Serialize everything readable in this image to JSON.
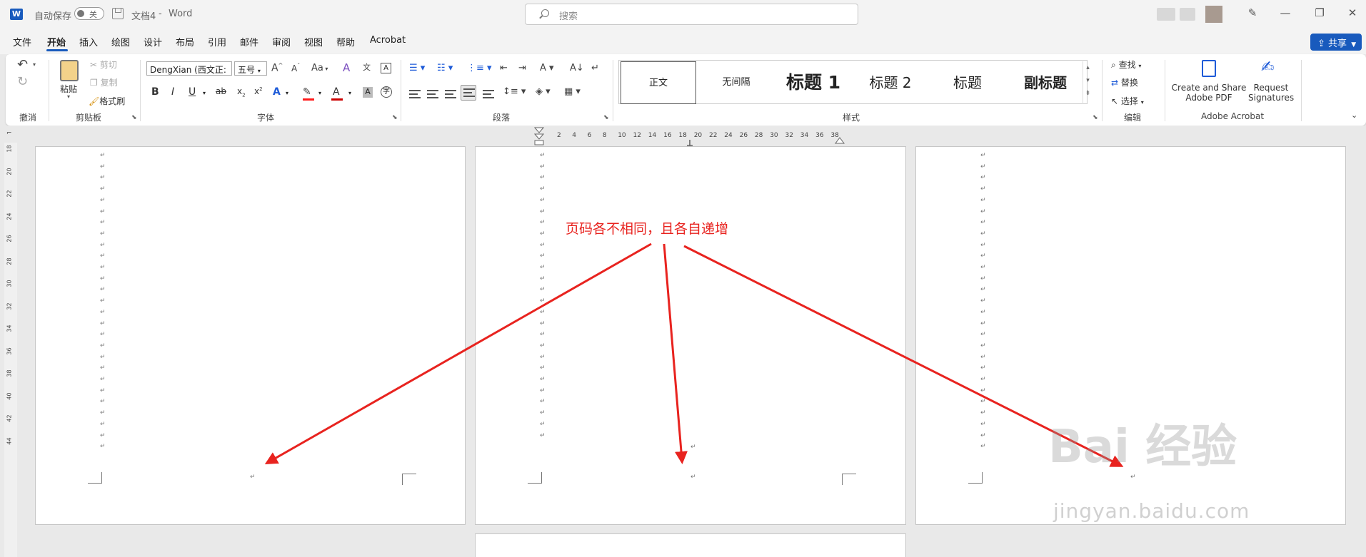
{
  "titlebar": {
    "autosave_label": "自动保存",
    "autosave_state": "关",
    "doc_title": "文档4",
    "separator": "-",
    "app_name": "Word",
    "search_placeholder": "搜索"
  },
  "menu": {
    "items": [
      "文件",
      "开始",
      "插入",
      "绘图",
      "设计",
      "布局",
      "引用",
      "邮件",
      "审阅",
      "视图",
      "帮助",
      "Acrobat"
    ],
    "active": "开始",
    "share_label": "共享"
  },
  "ribbon": {
    "undo": {
      "group": "撤消"
    },
    "clipboard": {
      "group": "剪贴板",
      "paste": "粘贴",
      "cut": "剪切",
      "copy": "复制",
      "format_painter": "格式刷"
    },
    "font": {
      "group": "字体",
      "font_name": "DengXian (西文正:",
      "font_size": "五号",
      "case_label": "Aa"
    },
    "paragraph": {
      "group": "段落"
    },
    "styles": {
      "group": "样式",
      "items": [
        "正文",
        "无间隔",
        "标题 1",
        "标题 2",
        "标题",
        "副标题"
      ]
    },
    "editing": {
      "group": "编辑",
      "find": "查找",
      "replace": "替换",
      "select": "选择"
    },
    "acrobat": {
      "group": "Adobe Acrobat",
      "create_share_1": "Create and Share",
      "create_share_2": "Adobe PDF",
      "request_1": "Request",
      "request_2": "Signatures"
    }
  },
  "ruler": {
    "horizontal": [
      "2",
      "4",
      "6",
      "8",
      "10",
      "12",
      "14",
      "16",
      "18",
      "20",
      "22",
      "24",
      "26",
      "28",
      "30",
      "32",
      "34",
      "36",
      "38"
    ],
    "vertical": [
      "18",
      "20",
      "22",
      "24",
      "26",
      "28",
      "30",
      "32",
      "34",
      "36",
      "38",
      "40",
      "42",
      "44"
    ]
  },
  "annotation": {
    "text": "页码各不相同，且各自递增",
    "color": "#e8231f"
  },
  "paragraph_mark": "↵",
  "watermark": {
    "main": "Bai 经验",
    "sub": "jingyan.baidu.com"
  },
  "colors": {
    "accent": "#185abd",
    "annotation": "#e8231f"
  }
}
